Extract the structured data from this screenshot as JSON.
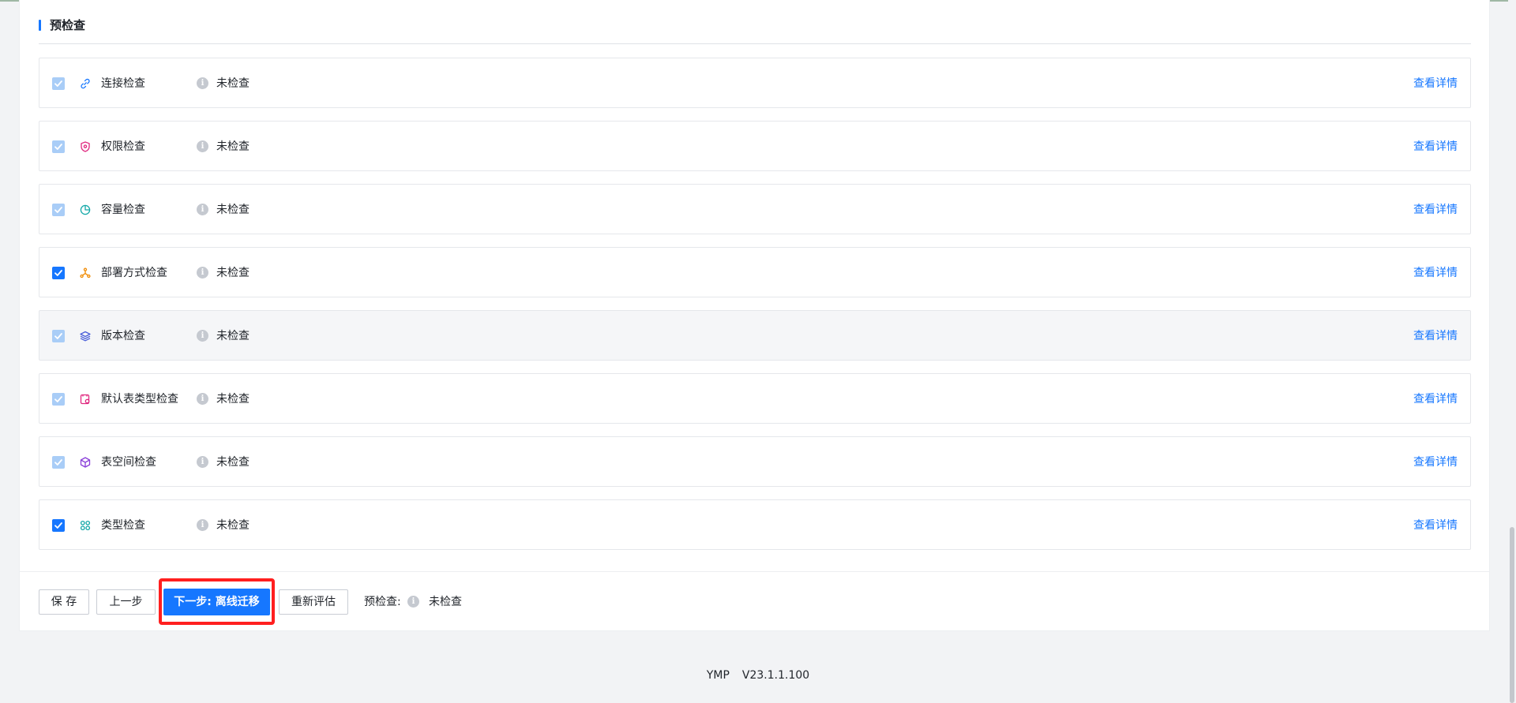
{
  "section": {
    "title": "预检查"
  },
  "checks": [
    {
      "label": "连接检查",
      "status": "未检查",
      "link": "查看详情",
      "checked": false,
      "icon": "link-icon",
      "color": "#1677ff"
    },
    {
      "label": "权限检查",
      "status": "未检查",
      "link": "查看详情",
      "checked": false,
      "icon": "shield-icon",
      "color": "#e0287f"
    },
    {
      "label": "容量检查",
      "status": "未检查",
      "link": "查看详情",
      "checked": false,
      "icon": "pie-chart-icon",
      "color": "#14a8a8"
    },
    {
      "label": "部署方式检查",
      "status": "未检查",
      "link": "查看详情",
      "checked": true,
      "icon": "cluster-icon",
      "color": "#f08a00"
    },
    {
      "label": "版本检查",
      "status": "未检查",
      "link": "查看详情",
      "checked": false,
      "icon": "layers-icon",
      "color": "#4a5fd9"
    },
    {
      "label": "默认表类型检查",
      "status": "未检查",
      "link": "查看详情",
      "checked": false,
      "icon": "table-type-icon",
      "color": "#e0287f"
    },
    {
      "label": "表空间检查",
      "status": "未检查",
      "link": "查看详情",
      "checked": false,
      "icon": "cube-icon",
      "color": "#8a3fd9"
    },
    {
      "label": "类型检查",
      "status": "未检查",
      "link": "查看详情",
      "checked": true,
      "icon": "grid-icon",
      "color": "#14a8a8"
    }
  ],
  "footer": {
    "save_label": "保 存",
    "prev_label": "上一步",
    "next_label": "下一步: 离线迁移",
    "reeval_label": "重新评估",
    "precheck_label": "预检查:",
    "precheck_status": "未检查"
  },
  "page_footer": {
    "brand": "YMP",
    "version": "V23.1.1.100"
  },
  "colors": {
    "accent": "#1677ff",
    "highlight_border": "#ff1f1f"
  }
}
